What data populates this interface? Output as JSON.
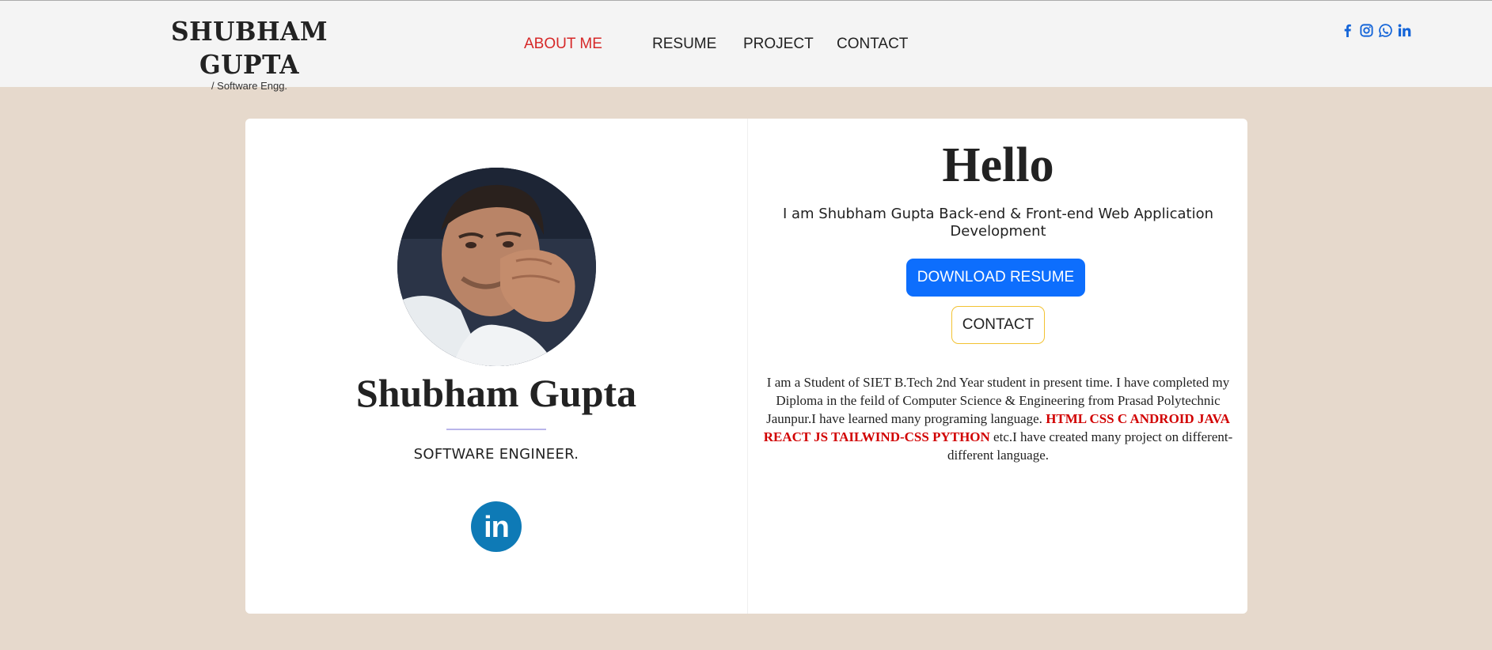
{
  "header": {
    "brand_name": "SHUBHAM GUPTA",
    "brand_sub": "/ Software Engg.",
    "nav": [
      {
        "label": "ABOUT ME",
        "active": true
      },
      {
        "label": "RESUME",
        "active": false
      },
      {
        "label": "PROJECT",
        "active": false
      },
      {
        "label": "CONTACT",
        "active": false
      }
    ],
    "social_icons": [
      "facebook-icon",
      "instagram-icon",
      "whatsapp-icon",
      "linkedin-icon"
    ]
  },
  "profile": {
    "name": "Shubham Gupta",
    "role": "SOFTWARE ENGINEER.",
    "linkedin_label": "in"
  },
  "intro": {
    "greeting": "Hello",
    "tagline": "I am Shubham Gupta Back-end & Front-end Web Application Development",
    "download_button": "DOWNLOAD RESUME",
    "contact_button": "CONTACT",
    "bio_before": "I am a Student of SIET B.Tech 2nd Year student in present time. I have completed my Diploma in the feild of Computer Science & Engineering from Prasad Polytechnic Jaunpur.I have learned many programing language. ",
    "bio_skills": "HTML CSS C ANDROID JAVA REACT JS TAILWIND-CSS PYTHON",
    "bio_after": " etc.I have created many project on different-different language."
  },
  "colors": {
    "page_bg": "#e6d9cc",
    "header_bg": "#f4f4f4",
    "accent_red": "#d62828",
    "primary_blue": "#0d6efd",
    "icon_blue": "#1565d8",
    "linkedin_blue": "#0e7ab6",
    "contact_border": "#f2c232"
  }
}
